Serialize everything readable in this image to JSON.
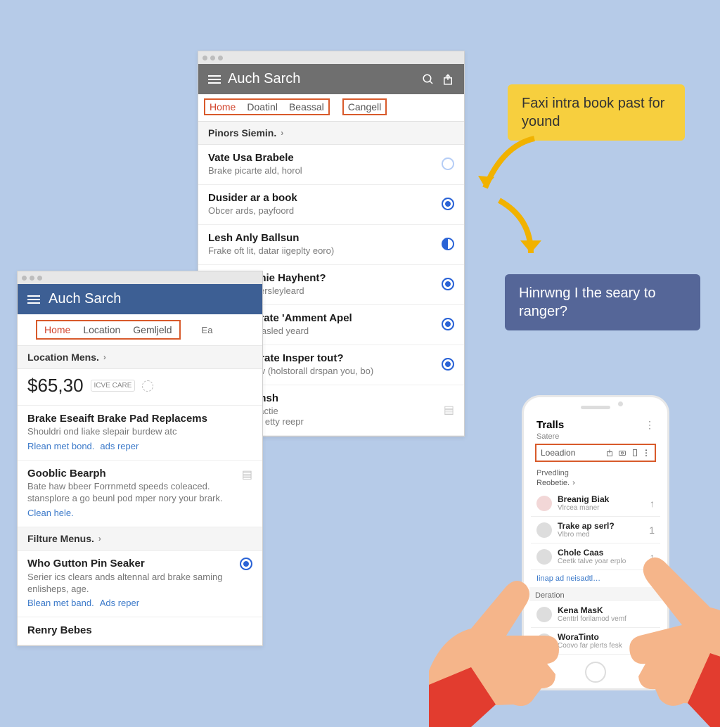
{
  "top_window": {
    "title": "Auch Sarch",
    "tabs": [
      "Home",
      "Doatinl",
      "Beassal",
      "Cangell"
    ],
    "section": "Pinors Siemin.",
    "items": [
      {
        "title": "Vate Usa Brabele",
        "sub": "Brake picarte ald, horol",
        "radio": "empty"
      },
      {
        "title": "Dusider ar a book",
        "sub": "Obcer ards, payfoord",
        "radio": "on"
      },
      {
        "title": "Lesh Anly Ballsun",
        "sub": "Frake oft lit, datar iigeplty eoro)",
        "radio": "half"
      },
      {
        "title": "Spart Gorinie Hayhent?",
        "sub": "Whert sas, persleyleard",
        "radio": "on"
      },
      {
        "title": "Ustar an drate 'Amment Apel",
        "sub": "Whert sriat clasled yeard",
        "radio": "on"
      },
      {
        "title": "Whr t do drate Insper tout?",
        "sub": "Othe's copliav (holstorall drspan you, bo)",
        "radio": "on"
      },
      {
        "title": "Lobal Bermsh",
        "sub": "Entve to poltactie",
        "sub2": "Bodurnc UI & etty reepr",
        "radio": "doc"
      }
    ]
  },
  "left_window": {
    "title": "Auch Sarch",
    "tabs": [
      "Home",
      "Location",
      "Gemljeld"
    ],
    "tabs_extra": "Ea",
    "section1": "Location Mens.",
    "price": "$65,30",
    "price_badge": "ICVE CARE",
    "card1": {
      "title": "Brake Eseaift Brake Pad Replacems",
      "desc": "Shouldri ond liake slepair burdew atc",
      "link1": "Rlean met bond.",
      "link2": "ads reper"
    },
    "card2": {
      "title": "Gooblic Bearph",
      "desc": "Bate haw bbeer Forrnmetd speeds coleaced. stansplore a go beunl pod mper nory your brark.",
      "link1": "Clean hele."
    },
    "section2": "Filture Menus.",
    "card3": {
      "title": "Who Gutton Pin Seaker",
      "desc": "Serier ics clears ands altennal ard brake saming enlisheps, age.",
      "link1": "Blean met band.",
      "link2": "Ads reper"
    },
    "card4": {
      "title": "Renry Bebes"
    }
  },
  "callouts": {
    "yellow": "Faxi intra book past for yound",
    "blue": "Hinrwng I the seary to ranger?"
  },
  "phone": {
    "header": "Tralls",
    "sub": "Satere",
    "loc_label": "Loeadion",
    "section1": "Prvedling",
    "listhead": "Reobetie.",
    "items": [
      {
        "name": "Breanig Biak",
        "meta": "Vlrcea maner",
        "car": true,
        "up": true
      },
      {
        "name": "Trake ap serl?",
        "meta": "Vlbro med",
        "car": false,
        "num": "1"
      },
      {
        "name": "Chole Caas",
        "meta": "Ceetk talve yoar erplo",
        "car": false,
        "up": true
      }
    ],
    "link": "Iinap ad neisadtl…",
    "section2": "Deration",
    "people": [
      {
        "name": "Kena MasK",
        "meta": "Centtrl forilamod vemf"
      },
      {
        "name": "WoraTinto",
        "meta": "Coovo far plerts fesk"
      }
    ]
  }
}
